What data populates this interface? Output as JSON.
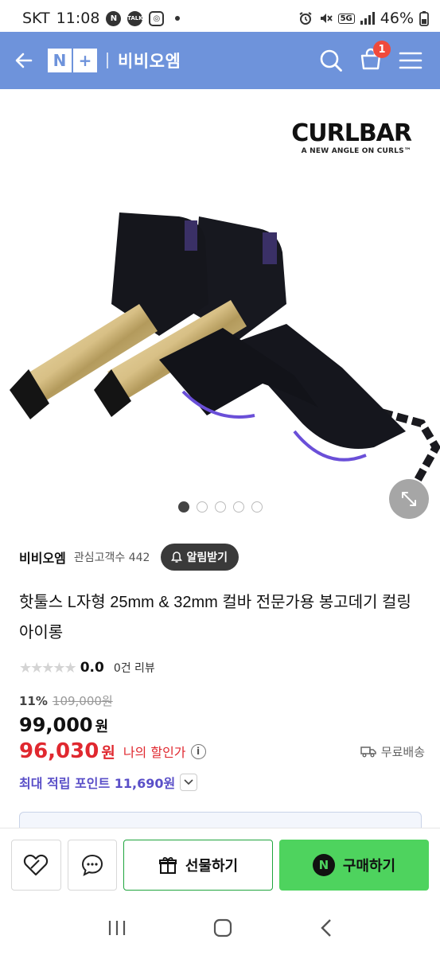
{
  "status": {
    "carrier": "SKT",
    "time": "11:08",
    "app_icons": [
      "N",
      "TALK"
    ],
    "network": "5G",
    "battery": "46%"
  },
  "header": {
    "logo_left": "N",
    "logo_right": "+",
    "title": "비비오엠",
    "cart_count": "1"
  },
  "hero": {
    "brand_main": "CURLBAR",
    "brand_sub": "A NEW ANGLE ON CURLS™",
    "image_count": 5,
    "active_index": 0
  },
  "product": {
    "store_name": "비비오엠",
    "fans_label": "관심고객수 442",
    "alert_label": "알림받기",
    "title": "핫툴스 L자형 25mm & 32mm 컬바 전문가용 봉고데기 컬링 아이롱",
    "rating_score": "0.0",
    "rating_value": 0,
    "review_count": "0건 리뷰",
    "discount_pct": "11%",
    "original_price": "109,000원",
    "price": "99,000",
    "price_unit": "원",
    "sale_price": "96,030",
    "sale_unit": "원",
    "my_discount_label": "나의 할인가",
    "shipping_label": "무료배송",
    "points_label": "최대 적립 포인트 11,690원"
  },
  "bottom": {
    "gift_label": "선물하기",
    "buy_label": "구매하기",
    "npay_mark": "N"
  },
  "colors": {
    "header_bg": "#6e93db",
    "sale_red": "#e0282f",
    "points_purple": "#5a4fc8",
    "buy_green": "#4ed35e",
    "gift_border": "#1fa43d"
  }
}
